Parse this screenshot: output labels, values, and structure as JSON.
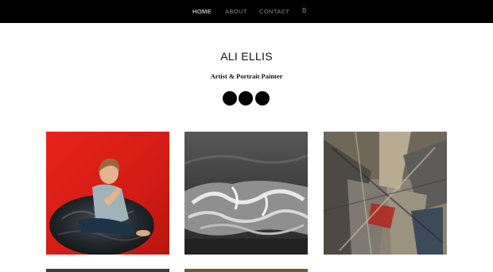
{
  "nav": {
    "home": "HOME",
    "about": "ABOUT",
    "contact": "CONTACT",
    "blog": "B"
  },
  "header": {
    "title": "ALI ELLIS",
    "subtitle": "Artist & Portrait Painter"
  },
  "social_links": [
    "social-icon-1",
    "social-icon-2",
    "social-icon-3"
  ],
  "gallery": [
    {
      "subject": "portrait of a boy on a beanbag against a red background"
    },
    {
      "subject": "charcoal drawing of draped white fabric"
    },
    {
      "subject": "abstract painting in grey, ochre and red"
    }
  ],
  "colors": {
    "topbar": "#000000",
    "nav_active": "#ffffff",
    "nav_inactive": "#8a8a8a",
    "text": "#111111"
  }
}
